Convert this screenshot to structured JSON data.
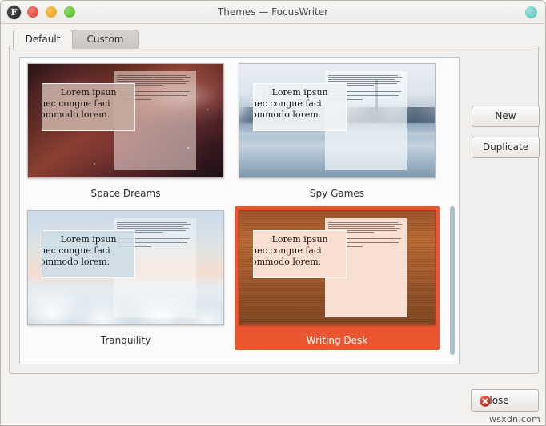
{
  "window": {
    "title": "Themes — FocusWriter",
    "app_icon": "focuswriter-icon",
    "app_icon_glyph": "F",
    "traffic_lights": [
      {
        "name": "close",
        "color": "#e8564c"
      },
      {
        "name": "minimize",
        "color": "#f0a92a"
      },
      {
        "name": "maximize",
        "color": "#62c63c"
      }
    ],
    "status_dot_color": "#6fcfc2"
  },
  "tabs": [
    {
      "label": "Default",
      "active": true
    },
    {
      "label": "Custom",
      "active": false
    }
  ],
  "side_buttons": {
    "new_label": "New",
    "duplicate_label": "Duplicate"
  },
  "themes": [
    {
      "name": "Space Dreams",
      "selected": false,
      "sample": {
        "line1": "Lorem ipsun",
        "line2": "nec congue faci",
        "line3": "ommodo lorem."
      }
    },
    {
      "name": "Spy Games",
      "selected": false,
      "sample": {
        "line1": "Lorem ipsun",
        "line2": "nec congue faci",
        "line3": "ommodo lorem."
      }
    },
    {
      "name": "Tranquility",
      "selected": false,
      "sample": {
        "line1": "Lorem ipsun",
        "line2": "nec congue faci",
        "line3": "ommodo lorem."
      }
    },
    {
      "name": "Writing Desk",
      "selected": true,
      "sample": {
        "line1": "Lorem ipsun",
        "line2": "nec congue faci",
        "line3": "ommodo lorem."
      }
    }
  ],
  "selection_color": "#e9562f",
  "footer": {
    "close_label": "Close",
    "close_icon": "error-circle-icon"
  },
  "watermark": "wsxdn.com"
}
